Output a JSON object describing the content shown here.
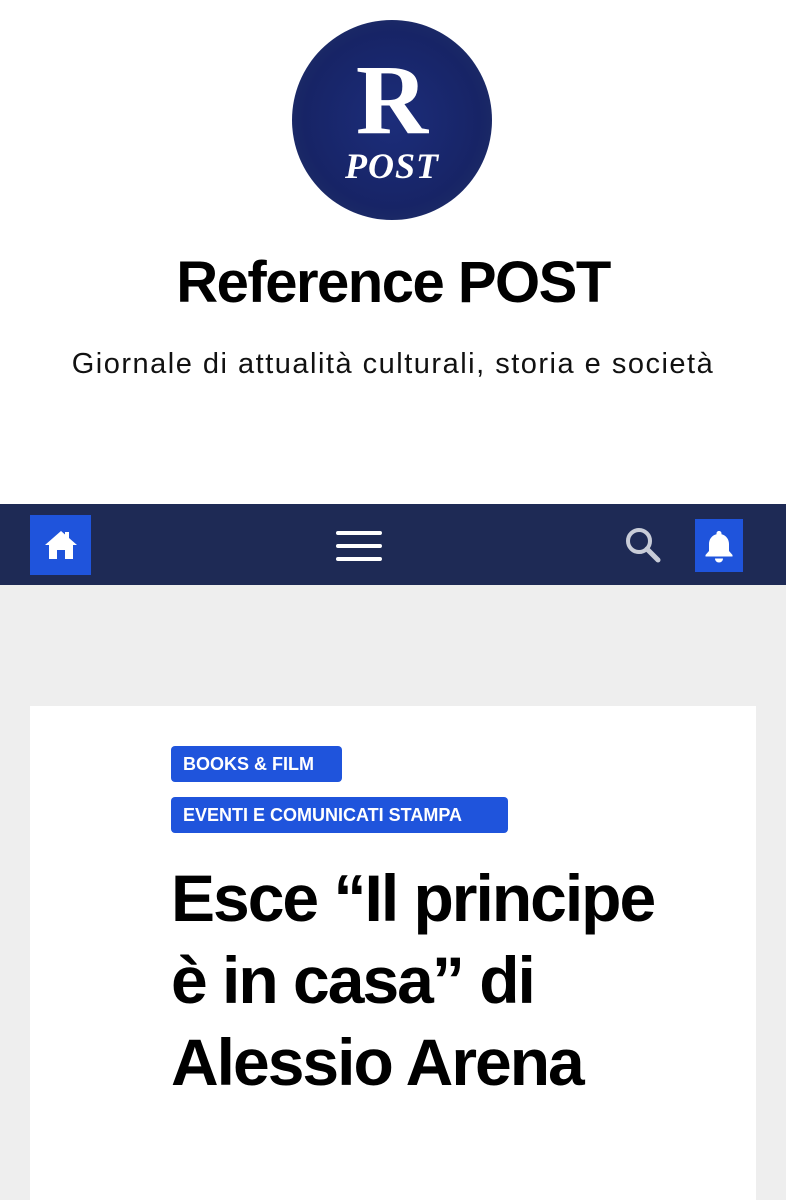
{
  "header": {
    "logo": {
      "letter": "R",
      "word": "POST"
    },
    "site_title": "Reference POST",
    "site_description": "Giornale di attualità culturali, storia e società"
  },
  "navbar": {
    "background_color": "#1e2a55",
    "accent_color": "#1f54dc",
    "home_icon": "home-icon",
    "menu_icon": "hamburger-menu-icon",
    "search_icon": "search-icon",
    "bell_icon": "bell-icon"
  },
  "article": {
    "categories": [
      "BOOKS & FILM",
      "EVENTI E COMUNICATI STAMPA"
    ],
    "title": "Esce “Il principe è in casa” di Alessio Arena"
  }
}
